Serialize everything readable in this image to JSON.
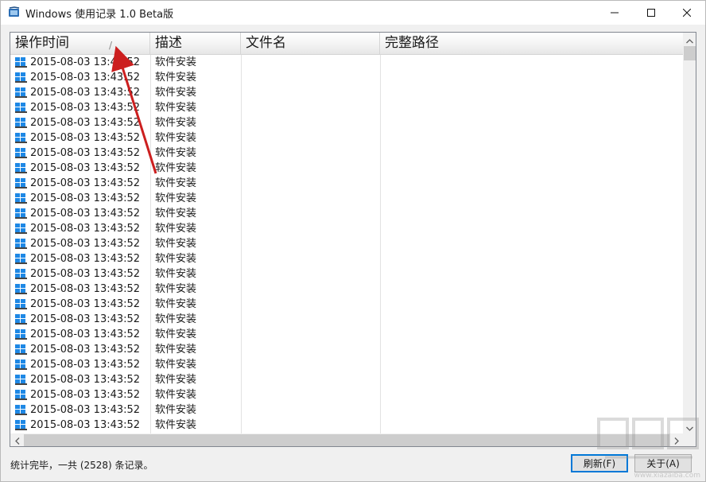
{
  "window": {
    "title": "Windows 使用记录 1.0 Beta版"
  },
  "icons": {
    "app": "app-icon",
    "minimize": "minimize-icon",
    "maximize": "maximize-icon",
    "close": "close-icon",
    "row": "windows-logo-icon"
  },
  "list": {
    "columns": [
      "操作时间",
      "描述",
      "文件名",
      "完整路径"
    ],
    "sort_indicator": "/",
    "rows": [
      {
        "time": "2015-08-03  13:43:52",
        "desc": "软件安装"
      },
      {
        "time": "2015-08-03  13:43:52",
        "desc": "软件安装"
      },
      {
        "time": "2015-08-03  13:43:52",
        "desc": "软件安装"
      },
      {
        "time": "2015-08-03  13:43:52",
        "desc": "软件安装"
      },
      {
        "time": "2015-08-03  13:43:52",
        "desc": "软件安装"
      },
      {
        "time": "2015-08-03  13:43:52",
        "desc": "软件安装"
      },
      {
        "time": "2015-08-03  13:43:52",
        "desc": "软件安装"
      },
      {
        "time": "2015-08-03  13:43:52",
        "desc": "软件安装"
      },
      {
        "time": "2015-08-03  13:43:52",
        "desc": "软件安装"
      },
      {
        "time": "2015-08-03  13:43:52",
        "desc": "软件安装"
      },
      {
        "time": "2015-08-03  13:43:52",
        "desc": "软件安装"
      },
      {
        "time": "2015-08-03  13:43:52",
        "desc": "软件安装"
      },
      {
        "time": "2015-08-03  13:43:52",
        "desc": "软件安装"
      },
      {
        "time": "2015-08-03  13:43:52",
        "desc": "软件安装"
      },
      {
        "time": "2015-08-03  13:43:52",
        "desc": "软件安装"
      },
      {
        "time": "2015-08-03  13:43:52",
        "desc": "软件安装"
      },
      {
        "time": "2015-08-03  13:43:52",
        "desc": "软件安装"
      },
      {
        "time": "2015-08-03  13:43:52",
        "desc": "软件安装"
      },
      {
        "time": "2015-08-03  13:43:52",
        "desc": "软件安装"
      },
      {
        "time": "2015-08-03  13:43:52",
        "desc": "软件安装"
      },
      {
        "time": "2015-08-03  13:43:52",
        "desc": "软件安装"
      },
      {
        "time": "2015-08-03  13:43:52",
        "desc": "软件安装"
      },
      {
        "time": "2015-08-03  13:43:52",
        "desc": "软件安装"
      },
      {
        "time": "2015-08-03  13:43:52",
        "desc": "软件安装"
      },
      {
        "time": "2015-08-03  13:43:52",
        "desc": "软件安装"
      }
    ]
  },
  "status": {
    "text": "统计完毕，一共 (2528) 条记录。"
  },
  "buttons": {
    "refresh": "刷新(F)",
    "about": "关于(A)"
  },
  "annotation": {
    "arrow_color": "#cc1f1f"
  },
  "watermark": {
    "text": "www.xiazaiba.com"
  }
}
